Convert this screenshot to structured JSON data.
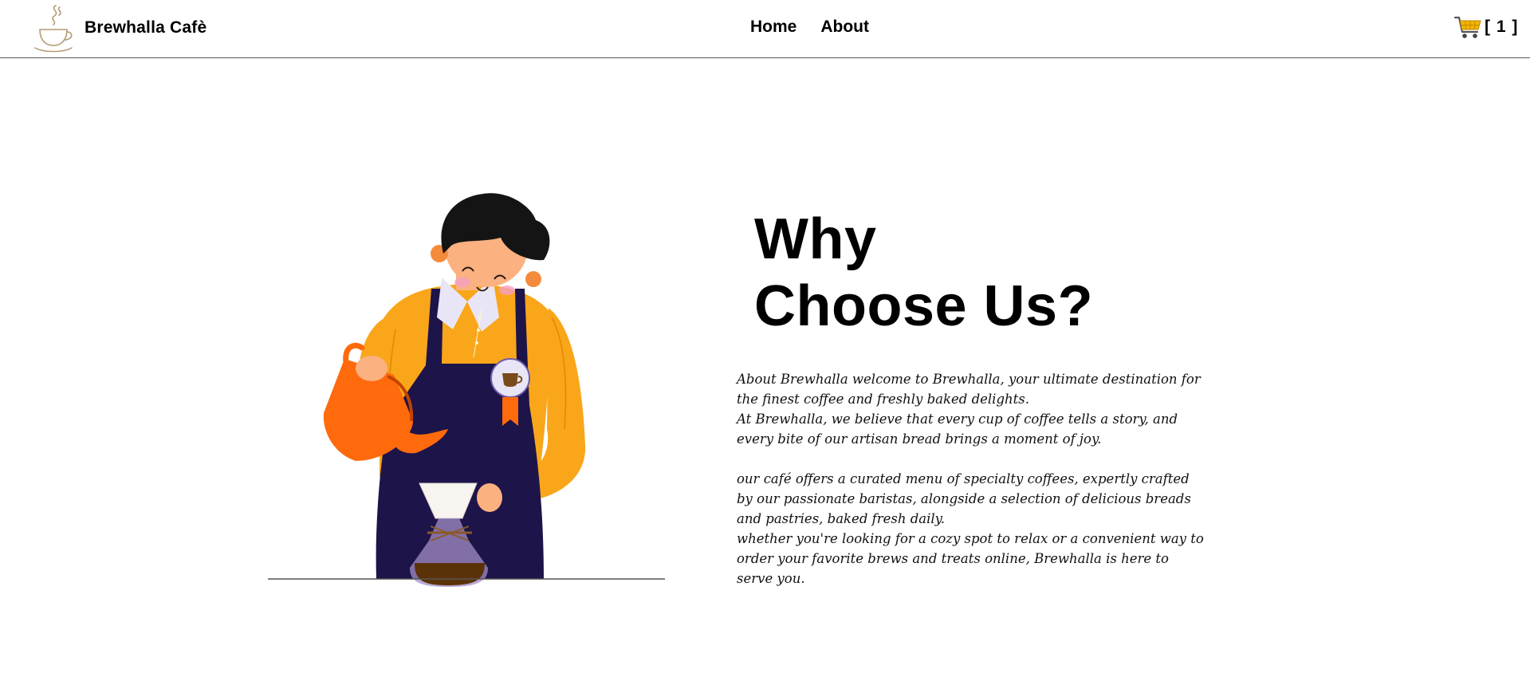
{
  "header": {
    "brand_name": "Brewhalla Cafè",
    "logo_icon": "coffee-cup-logo-icon",
    "nav": [
      {
        "label": "Home"
      },
      {
        "label": "About"
      }
    ],
    "cart": {
      "icon": "shopping-cart-icon",
      "count_text": "[ 1 ]",
      "icon_color": "#f4b400"
    }
  },
  "hero": {
    "heading_line1": "Why",
    "heading_line2": "Choose Us?",
    "illustration_icon": "barista-pouring-coffee-illustration",
    "paragraph1_line1": "About Brewhalla welcome to Brewhalla, your ultimate destination for the finest coffee and freshly baked delights.",
    "paragraph1_line2": "At Brewhalla, we believe that every cup of coffee tells a story, and every bite of our artisan bread brings a moment of joy.",
    "paragraph2_line1": "our café offers a curated menu of specialty coffees, expertly crafted by our passionate baristas, alongside a selection of delicious breads and pastries, baked fresh daily.",
    "paragraph2_line2": "whether you're looking for a cozy spot to relax or a convenient way to order your favorite brews and treats online, Brewhalla is here to serve you."
  },
  "colors": {
    "shirt": "#f9a61a",
    "apron": "#1d1449",
    "kettle": "#ff6a0d",
    "hair": "#141414",
    "divider": "#555555"
  }
}
